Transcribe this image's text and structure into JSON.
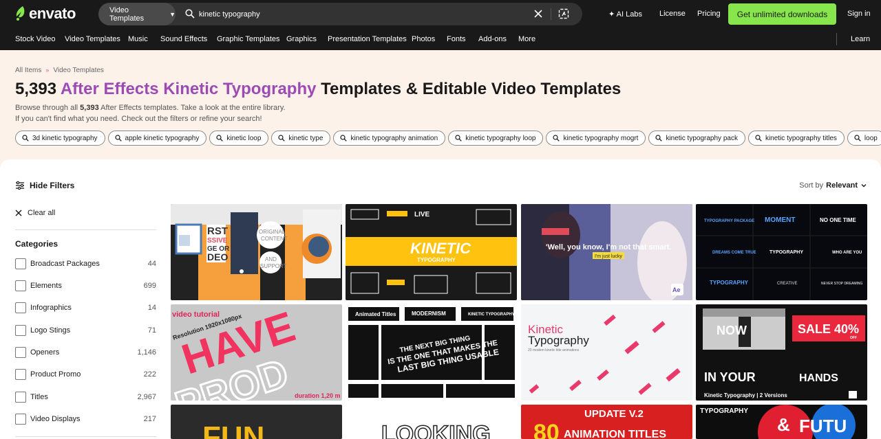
{
  "header": {
    "logo_text": "envato",
    "category_select": "Video Templates",
    "search_value": "kinetic typography",
    "search_placeholder": "Search",
    "nav": [
      "AI Labs",
      "License",
      "Pricing"
    ],
    "cta": "Get unlimited downloads",
    "signin": "Sign in"
  },
  "catnav": {
    "items": [
      "Stock Video",
      "Video Templates",
      "Music",
      "Sound Effects",
      "Graphic Templates",
      "Graphics",
      "Presentation Templates",
      "Photos",
      "Fonts",
      "Add-ons",
      "More"
    ],
    "learn": "Learn"
  },
  "hero": {
    "breadcrumb": [
      "All Items",
      "Video Templates"
    ],
    "count": "5,393",
    "title_highlight": "After Effects Kinetic Typography",
    "title_rest": "Templates & Editable Video Templates",
    "desc_1": "Browse through all",
    "desc_count": "5,393",
    "desc_2": "After Effects templates. Take a look at the entire library.",
    "desc_3": "If you can't find what you need. Check out the filters or refine your search!",
    "tags": [
      "3d kinetic typography",
      "apple kinetic typography",
      "kinetic loop",
      "kinetic type",
      "kinetic typography animation",
      "kinetic typography loop",
      "kinetic typography mogrt",
      "kinetic typography pack",
      "kinetic typography titles",
      "loop"
    ]
  },
  "filters": {
    "hide_label": "Hide Filters",
    "clear_label": "Clear all",
    "categories_title": "Categories",
    "categories": [
      {
        "label": "Broadcast Packages",
        "count": "44"
      },
      {
        "label": "Elements",
        "count": "699"
      },
      {
        "label": "Infographics",
        "count": "14"
      },
      {
        "label": "Logo Stings",
        "count": "71"
      },
      {
        "label": "Openers",
        "count": "1,146"
      },
      {
        "label": "Product Promo",
        "count": "222"
      },
      {
        "label": "Titles",
        "count": "2,967"
      },
      {
        "label": "Video Displays",
        "count": "217"
      }
    ]
  },
  "sort": {
    "label": "Sort by",
    "value": "Relevant"
  },
  "cards": {
    "c1_text": [
      "RST",
      "SSIVE",
      "GE OR",
      "DEO",
      "ORIGINAL",
      "CONTENT",
      "AND",
      "SUPPORT"
    ],
    "c2_text": [
      "LIVE",
      "KINETIC",
      "TYPOGRAPHY"
    ],
    "c3_text": [
      "'Well, you know, I'm not that smart.",
      "I'm just lucky",
      "Ae"
    ],
    "c4_text": [
      "TYPOGRAPHY PACKAGE",
      "MOMENT",
      "NO ONE TIME",
      "DREAMS COME TRUE",
      "TYPOGRAPHY",
      "WHO ARE YOU",
      "TYPOGRAPHY",
      "CREATIVE",
      "NEVER STOP DREAMING"
    ],
    "c5_text": [
      "HAVE",
      "PROD",
      "video tutorial",
      "Resolution 1920x1080px",
      "duration 1,20 m"
    ],
    "c6_text": [
      "Animated Titles",
      "MODERNISM",
      "KINETIC TYPOGRAPHY",
      "THE NEXT BIG THING",
      "IS THE ONE THAT MAKES THE",
      "LAST BIG THING USABLE"
    ],
    "c7_text": [
      "Kinetic",
      "Typography",
      "20 modern kinetic title animations"
    ],
    "c8_text": [
      "SALE 40%",
      "OFF",
      "NOW",
      "IN YOUR",
      "HANDS",
      "Kinetic Typography | 2 Versions"
    ],
    "c9_text": [
      "FUN"
    ],
    "c10_text": [
      "LOOKING"
    ],
    "c11_text": [
      "UPDATE V.2",
      "80",
      "ANIMATION TITLES"
    ],
    "c12_text": [
      "TYPOGRAPHY",
      "&",
      "FUTU"
    ]
  },
  "colors": {
    "topbar": "#191919",
    "accent_green": "#87e64b",
    "highlight_purple": "#9c4ab4",
    "hero_bg": "#fcf2ea"
  }
}
